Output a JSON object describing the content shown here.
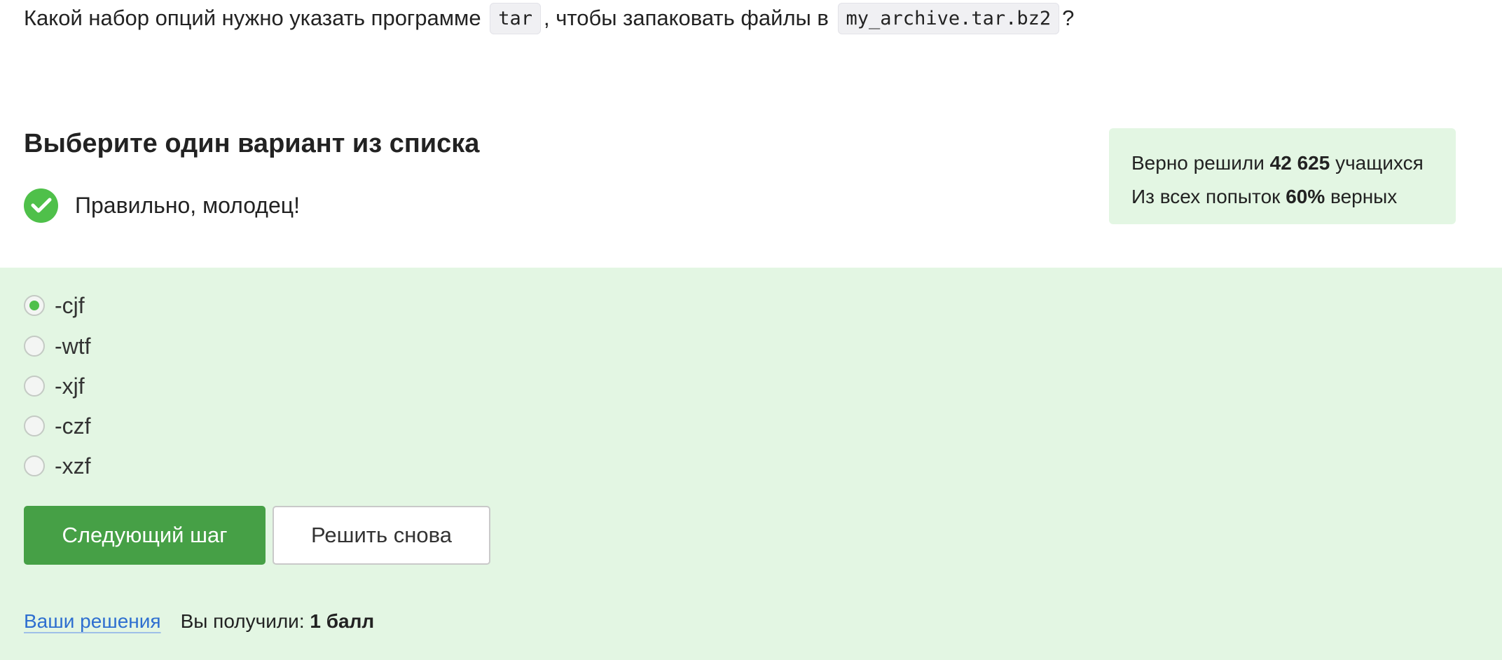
{
  "question": {
    "part1": "Какой набор опций нужно указать программе",
    "code1": "tar",
    "part2": ", чтобы запаковать файлы в",
    "code2": "my_archive.tar.bz2",
    "part3": "?"
  },
  "task": {
    "heading": "Выберите один вариант из списка",
    "feedback": "Правильно, молодец!"
  },
  "stats": {
    "solved_prefix": "Верно решили",
    "solved_count": "42 625",
    "solved_suffix": "учащихся",
    "attempts_prefix": "Из всех попыток",
    "attempts_percent": "60%",
    "attempts_suffix": "верных"
  },
  "options": [
    {
      "label": "-cjf",
      "selected": true
    },
    {
      "label": "-wtf",
      "selected": false
    },
    {
      "label": "-xjf",
      "selected": false
    },
    {
      "label": "-czf",
      "selected": false
    },
    {
      "label": "-xzf",
      "selected": false
    }
  ],
  "buttons": {
    "next": "Следующий шаг",
    "retry": "Решить снова"
  },
  "footer": {
    "solutions_link": "Ваши решения",
    "score_prefix": "Вы получили:",
    "score_value": "1 балл"
  },
  "colors": {
    "success_green": "#4fc04a",
    "button_green": "#46a046",
    "section_bg": "#e3f6e3",
    "link_blue": "#2e6fd0"
  }
}
